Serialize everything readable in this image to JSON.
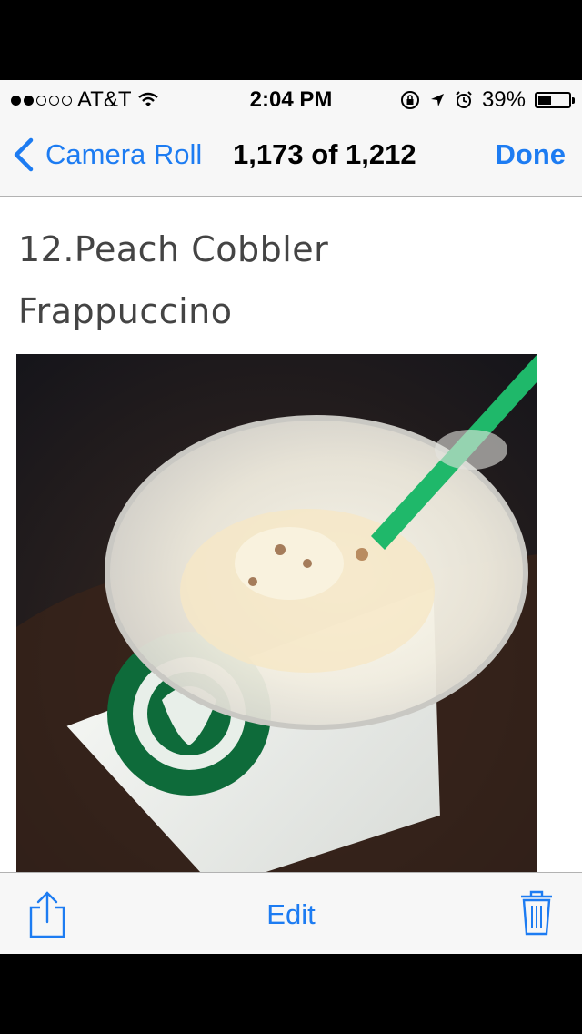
{
  "status_bar": {
    "carrier": "AT&T",
    "signal_bars_filled": 2,
    "signal_bars_total": 5,
    "time": "2:04 PM",
    "battery_percent": "39%"
  },
  "nav": {
    "back_label": "Camera Roll",
    "title": "1,173 of 1,212",
    "done_label": "Done",
    "accent_color": "#1d7cf2"
  },
  "content": {
    "heading_line1": "12.Peach Cobbler",
    "heading_line2": "Frappuccino"
  },
  "toolbar": {
    "share_icon": "share-icon",
    "edit_label": "Edit",
    "trash_icon": "trash-icon"
  }
}
